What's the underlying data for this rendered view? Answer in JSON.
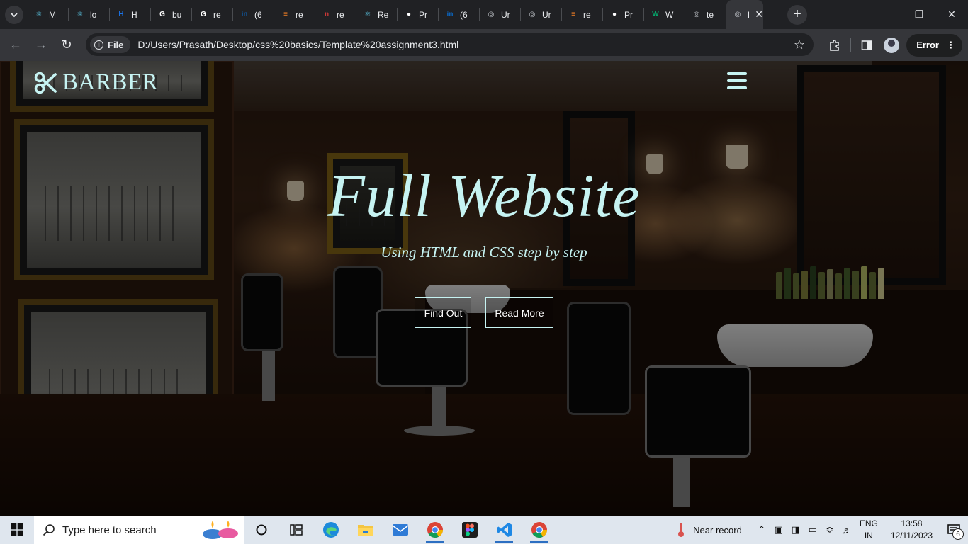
{
  "browser": {
    "tabs": [
      {
        "title": "M",
        "icon": "react-icon",
        "color": "#61dafb"
      },
      {
        "title": "lo",
        "icon": "react-icon",
        "color": "#61dafb"
      },
      {
        "title": "H",
        "icon": "hackerrank-icon",
        "color": "#1a73e8"
      },
      {
        "title": "bu",
        "icon": "google-icon",
        "color": "#ffffff"
      },
      {
        "title": "re",
        "icon": "google-icon",
        "color": "#ffffff"
      },
      {
        "title": "(6",
        "icon": "linkedin-icon",
        "color": "#0a66c2"
      },
      {
        "title": "re",
        "icon": "stackoverflow-icon",
        "color": "#f48024"
      },
      {
        "title": "re",
        "icon": "npm-icon",
        "color": "#cb3837"
      },
      {
        "title": "Re",
        "icon": "react-icon",
        "color": "#61dafb"
      },
      {
        "title": "Pr",
        "icon": "github-icon",
        "color": "#ffffff"
      },
      {
        "title": "(6",
        "icon": "linkedin-icon",
        "color": "#0a66c2"
      },
      {
        "title": "Ur",
        "icon": "globe-icon",
        "color": "#bdc1c6"
      },
      {
        "title": "Ur",
        "icon": "globe-icon",
        "color": "#bdc1c6"
      },
      {
        "title": "re",
        "icon": "stackoverflow-icon",
        "color": "#f48024"
      },
      {
        "title": "Pr",
        "icon": "github-icon",
        "color": "#ffffff"
      },
      {
        "title": "W",
        "icon": "w3schools-icon",
        "color": "#04aa6d"
      },
      {
        "title": "te",
        "icon": "globe-icon",
        "color": "#bdc1c6"
      },
      {
        "title": "Di",
        "icon": "globe-icon",
        "color": "#bdc1c6"
      }
    ],
    "address": {
      "chip_label": "File",
      "url": "D:/Users/Prasath/Desktop/css%20basics/Template%20assignment3.html"
    },
    "profile_status": "Error"
  },
  "page": {
    "logo_text": "BARBER",
    "headline": "Full Website",
    "subheadline": "Using HTML and CSS step by step",
    "buttons": {
      "find_out": "Find Out",
      "read_more": "Read More"
    },
    "accent_color": "#c6f3f2"
  },
  "taskbar": {
    "search_placeholder": "Type here to search",
    "weather_text": "Near record",
    "language": {
      "line1": "ENG",
      "line2": "IN"
    },
    "time": "13:58",
    "date": "12/11/2023",
    "notification_count": "6"
  }
}
